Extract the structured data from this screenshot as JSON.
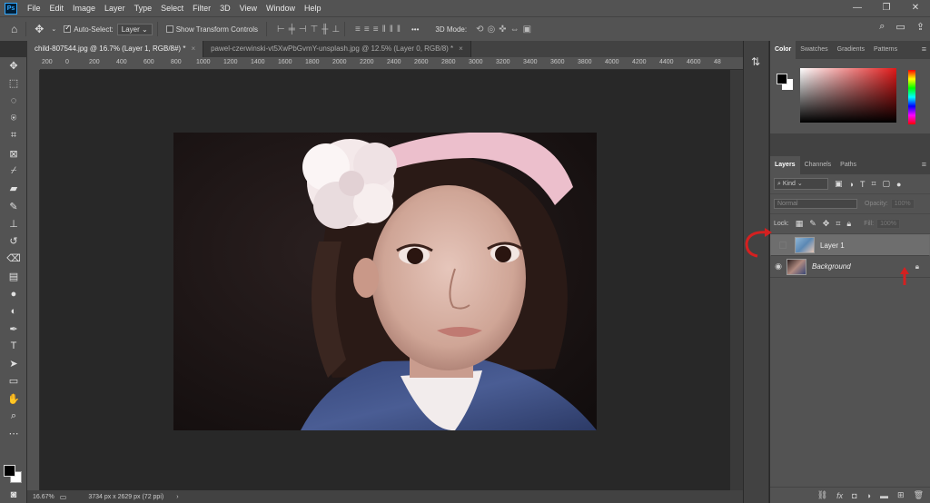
{
  "menu": [
    "File",
    "Edit",
    "Image",
    "Layer",
    "Type",
    "Select",
    "Filter",
    "3D",
    "View",
    "Window",
    "Help"
  ],
  "app_logo": "Ps",
  "window_controls": [
    "—",
    "❐",
    "✕"
  ],
  "options": {
    "auto_select_label": "Auto-Select:",
    "auto_select_value": "Layer",
    "show_transform_label": "Show Transform Controls",
    "mode_label": "3D Mode:",
    "more": "•••"
  },
  "tabs": [
    {
      "label": "child-807544.jpg @ 16.7% (Layer 1, RGB/8#) *",
      "active": true
    },
    {
      "label": "pawel-czerwinski-vt5XwPbGvmY-unsplash.jpg @ 12.5% (Layer 0, RGB/8) *",
      "active": false
    }
  ],
  "tab_close": "×",
  "ruler_ticks": [
    "200",
    "0",
    "200",
    "400",
    "600",
    "800",
    "1000",
    "1200",
    "1400",
    "1600",
    "1800",
    "2000",
    "2200",
    "2400",
    "2600",
    "2800",
    "3000",
    "3200",
    "3400",
    "3600",
    "3800",
    "4000",
    "4200",
    "4400",
    "4600",
    "48"
  ],
  "status": {
    "zoom": "16.67%",
    "doc_info": "3734 px x 2629 px (72 ppi)",
    "arrow": "›"
  },
  "color_panel": {
    "tabs": [
      "Color",
      "Swatches",
      "Gradients",
      "Patterns"
    ]
  },
  "layers_panel": {
    "tabs": [
      "Layers",
      "Channels",
      "Paths"
    ],
    "kind_label": "Kind",
    "blend_mode": "Normal",
    "opacity_label": "Opacity:",
    "opacity_value": "100%",
    "lock_label": "Lock:",
    "fill_label": "Fill:",
    "fill_value": "100%",
    "layers": [
      {
        "name": "Layer 1",
        "visible": false,
        "selected": true
      },
      {
        "name": "Background",
        "visible": true,
        "selected": false,
        "locked": true
      }
    ]
  },
  "colors": {
    "accent": "#31a8ff",
    "annotation": "#d42020",
    "foreground": "#000000",
    "background": "#ffffff"
  }
}
